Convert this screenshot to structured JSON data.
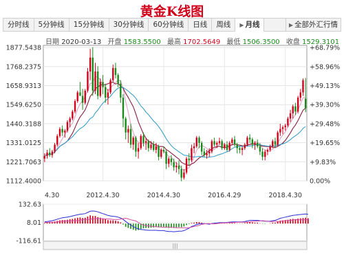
{
  "title": "黄金K线图",
  "tabs": [
    {
      "label": "分时线",
      "active": false
    },
    {
      "label": "5分钟线",
      "active": false
    },
    {
      "label": "15分钟线",
      "active": false
    },
    {
      "label": "30分钟线",
      "active": false
    },
    {
      "label": "60分钟线",
      "active": false
    },
    {
      "label": "日线",
      "active": false
    },
    {
      "label": "周线",
      "active": false
    },
    {
      "label": "月线",
      "active": true
    }
  ],
  "all_markets_label": "全部外汇行情",
  "info": {
    "date_label": "日期",
    "date_value": "2020-03-13",
    "open_label": "开盘",
    "open_value": "1583.5500",
    "high_label": "最高",
    "high_value": "1702.5649",
    "low_label": "最低",
    "low_value": "1506.3500",
    "close_label": "收盘",
    "close_value": "1529.3101"
  },
  "colors": {
    "up": "#d0021b",
    "down": "#1a8a1a",
    "ma_short": "#e0a3c8",
    "ma_mid": "#8b1c3d",
    "ma_long": "#3aa0c9",
    "title": "#d0021b"
  },
  "chart_data": [
    {
      "type": "candlestick",
      "period": "monthly",
      "y_tick_labels": [
        "1877.5438",
        "1768.2375",
        "1658.9313",
        "1549.6250",
        "1440.3188",
        "1331.0125",
        "1221.7063",
        "1112.4000"
      ],
      "y_tick_values": [
        1877.5438,
        1768.2375,
        1658.9313,
        1549.625,
        1440.3188,
        1331.0125,
        1221.7063,
        1112.4
      ],
      "right_tick_labels": [
        "+68.79%",
        "+58.96%",
        "+49.13%",
        "+39.30%",
        "+29.48%",
        "+19.65%",
        "+9.83%",
        "0.00%"
      ],
      "x_tick_labels": [
        "4.30",
        "2012.4.30",
        "2014.4.30",
        "2016.4.29",
        "2018.4.30"
      ],
      "x_tick_index": [
        0,
        23,
        47,
        71,
        95
      ],
      "ylim": [
        1112.4,
        1890
      ],
      "ohlc": [
        [
          1240,
          1270,
          1220,
          1255
        ],
        [
          1255,
          1290,
          1240,
          1275
        ],
        [
          1275,
          1300,
          1250,
          1260
        ],
        [
          1260,
          1290,
          1245,
          1280
        ],
        [
          1280,
          1330,
          1270,
          1320
        ],
        [
          1320,
          1380,
          1310,
          1370
        ],
        [
          1370,
          1420,
          1360,
          1410
        ],
        [
          1410,
          1430,
          1370,
          1390
        ],
        [
          1390,
          1410,
          1360,
          1400
        ],
        [
          1400,
          1460,
          1390,
          1450
        ],
        [
          1450,
          1480,
          1420,
          1470
        ],
        [
          1470,
          1520,
          1460,
          1510
        ],
        [
          1510,
          1580,
          1500,
          1570
        ],
        [
          1570,
          1630,
          1560,
          1620
        ],
        [
          1620,
          1680,
          1610,
          1600
        ],
        [
          1600,
          1640,
          1520,
          1560
        ],
        [
          1560,
          1640,
          1550,
          1630
        ],
        [
          1630,
          1760,
          1620,
          1740
        ],
        [
          1740,
          1870,
          1690,
          1820
        ],
        [
          1820,
          1880,
          1600,
          1630
        ],
        [
          1630,
          1790,
          1610,
          1740
        ],
        [
          1740,
          1770,
          1580,
          1600
        ],
        [
          1600,
          1700,
          1590,
          1680
        ],
        [
          1680,
          1720,
          1610,
          1650
        ],
        [
          1650,
          1670,
          1560,
          1590
        ],
        [
          1590,
          1640,
          1550,
          1620
        ],
        [
          1620,
          1700,
          1610,
          1690
        ],
        [
          1690,
          1780,
          1680,
          1760
        ],
        [
          1760,
          1790,
          1700,
          1720
        ],
        [
          1720,
          1730,
          1650,
          1670
        ],
        [
          1670,
          1690,
          1560,
          1590
        ],
        [
          1590,
          1610,
          1420,
          1470
        ],
        [
          1470,
          1480,
          1350,
          1390
        ],
        [
          1390,
          1430,
          1330,
          1410
        ],
        [
          1410,
          1440,
          1300,
          1320
        ],
        [
          1320,
          1370,
          1290,
          1360
        ],
        [
          1360,
          1370,
          1250,
          1280
        ],
        [
          1280,
          1330,
          1240,
          1300
        ],
        [
          1300,
          1380,
          1290,
          1370
        ],
        [
          1370,
          1390,
          1310,
          1330
        ],
        [
          1330,
          1360,
          1290,
          1340
        ],
        [
          1340,
          1350,
          1280,
          1300
        ],
        [
          1300,
          1340,
          1290,
          1320
        ],
        [
          1320,
          1340,
          1280,
          1290
        ],
        [
          1290,
          1330,
          1270,
          1310
        ],
        [
          1310,
          1320,
          1230,
          1250
        ],
        [
          1250,
          1300,
          1240,
          1290
        ],
        [
          1290,
          1310,
          1270,
          1280
        ],
        [
          1280,
          1290,
          1180,
          1210
        ],
        [
          1210,
          1250,
          1190,
          1240
        ],
        [
          1240,
          1260,
          1200,
          1220
        ],
        [
          1220,
          1240,
          1170,
          1190
        ],
        [
          1190,
          1220,
          1160,
          1200
        ],
        [
          1200,
          1230,
          1150,
          1180
        ],
        [
          1180,
          1200,
          1110,
          1130
        ],
        [
          1130,
          1180,
          1120,
          1160
        ],
        [
          1160,
          1250,
          1150,
          1240
        ],
        [
          1240,
          1270,
          1200,
          1230
        ],
        [
          1230,
          1320,
          1220,
          1300
        ],
        [
          1300,
          1330,
          1270,
          1310
        ],
        [
          1310,
          1370,
          1300,
          1360
        ],
        [
          1360,
          1370,
          1300,
          1330
        ],
        [
          1330,
          1340,
          1260,
          1280
        ],
        [
          1280,
          1300,
          1250,
          1260
        ],
        [
          1260,
          1290,
          1240,
          1270
        ],
        [
          1270,
          1300,
          1250,
          1280
        ],
        [
          1280,
          1350,
          1270,
          1340
        ],
        [
          1340,
          1360,
          1310,
          1320
        ],
        [
          1320,
          1340,
          1300,
          1330
        ],
        [
          1330,
          1360,
          1320,
          1340
        ],
        [
          1340,
          1350,
          1290,
          1300
        ],
        [
          1300,
          1330,
          1290,
          1320
        ],
        [
          1320,
          1340,
          1280,
          1290
        ],
        [
          1290,
          1340,
          1280,
          1330
        ],
        [
          1330,
          1360,
          1320,
          1350
        ],
        [
          1350,
          1370,
          1310,
          1320
        ],
        [
          1320,
          1330,
          1270,
          1300
        ],
        [
          1300,
          1310,
          1270,
          1290
        ],
        [
          1290,
          1310,
          1260,
          1300
        ],
        [
          1300,
          1330,
          1290,
          1320
        ],
        [
          1320,
          1370,
          1310,
          1360
        ],
        [
          1360,
          1380,
          1330,
          1350
        ],
        [
          1350,
          1360,
          1300,
          1320
        ],
        [
          1320,
          1340,
          1290,
          1330
        ],
        [
          1330,
          1350,
          1300,
          1310
        ],
        [
          1310,
          1330,
          1260,
          1280
        ],
        [
          1280,
          1300,
          1230,
          1250
        ],
        [
          1250,
          1290,
          1230,
          1280
        ],
        [
          1280,
          1300,
          1260,
          1290
        ],
        [
          1290,
          1320,
          1280,
          1310
        ],
        [
          1310,
          1350,
          1300,
          1340
        ],
        [
          1340,
          1360,
          1300,
          1320
        ],
        [
          1320,
          1400,
          1310,
          1390
        ],
        [
          1390,
          1440,
          1370,
          1410
        ],
        [
          1410,
          1430,
          1380,
          1420
        ],
        [
          1420,
          1440,
          1400,
          1430
        ],
        [
          1430,
          1480,
          1420,
          1470
        ],
        [
          1470,
          1520,
          1450,
          1500
        ],
        [
          1500,
          1550,
          1470,
          1540
        ],
        [
          1540,
          1560,
          1490,
          1510
        ],
        [
          1510,
          1600,
          1500,
          1590
        ],
        [
          1590,
          1640,
          1570,
          1620
        ],
        [
          1620,
          1700,
          1600,
          1690
        ],
        [
          1583.55,
          1702.5649,
          1506.35,
          1529.3101
        ]
      ]
    },
    {
      "type": "macd-histogram",
      "y_tick_labels": [
        "132.63",
        "8.01",
        "-116.61"
      ],
      "y_tick_values": [
        132.63,
        8.01,
        -116.61
      ],
      "ylim": [
        -116.61,
        132.63
      ],
      "histogram": [
        4,
        6,
        8,
        10,
        14,
        18,
        22,
        24,
        24,
        26,
        30,
        32,
        36,
        40,
        42,
        38,
        40,
        48,
        56,
        52,
        52,
        44,
        40,
        36,
        30,
        24,
        22,
        22,
        20,
        16,
        8,
        -6,
        -22,
        -30,
        -36,
        -42,
        -48,
        -44,
        -36,
        -32,
        -30,
        -30,
        -28,
        -26,
        -24,
        -26,
        -24,
        -22,
        -28,
        -30,
        -28,
        -30,
        -26,
        -24,
        -24,
        -20,
        -10,
        -4,
        4,
        6,
        10,
        10,
        6,
        2,
        -2,
        -4,
        2,
        4,
        4,
        4,
        2,
        2,
        2,
        4,
        6,
        4,
        2,
        2,
        2,
        4,
        8,
        10,
        8,
        6,
        6,
        2,
        -2,
        -2,
        0,
        2,
        6,
        6,
        14,
        20,
        22,
        24,
        26,
        30,
        32,
        30,
        34,
        36,
        38,
        40,
        36
      ],
      "dif": [
        12,
        14,
        17,
        20,
        24,
        30,
        35,
        40,
        42,
        44,
        48,
        52,
        56,
        60,
        64,
        66,
        68,
        76,
        84,
        86,
        84,
        80,
        74,
        68,
        62,
        56,
        52,
        50,
        48,
        44,
        38,
        28,
        14,
        2,
        -10,
        -20,
        -30,
        -36,
        -40,
        -42,
        -44,
        -46,
        -46,
        -46,
        -46,
        -48,
        -48,
        -48,
        -52,
        -54,
        -54,
        -56,
        -54,
        -52,
        -52,
        -48,
        -40,
        -32,
        -20,
        -14,
        -6,
        -2,
        0,
        0,
        -2,
        -4,
        0,
        2,
        4,
        6,
        6,
        6,
        8,
        10,
        12,
        12,
        12,
        12,
        12,
        14,
        18,
        22,
        22,
        22,
        22,
        20,
        18,
        16,
        16,
        16,
        20,
        22,
        28,
        36,
        40,
        44,
        48,
        52,
        56,
        58,
        60,
        62,
        64,
        66,
        64
      ],
      "dea": [
        8,
        8,
        9,
        10,
        10,
        12,
        13,
        16,
        18,
        18,
        18,
        20,
        20,
        20,
        22,
        28,
        28,
        28,
        28,
        34,
        32,
        36,
        34,
        32,
        32,
        32,
        30,
        28,
        28,
        28,
        30,
        34,
        36,
        32,
        26,
        22,
        18,
        8,
        -4,
        -10,
        -14,
        -16,
        -18,
        -20,
        -22,
        -22,
        -24,
        -26,
        -24,
        -24,
        -26,
        -26,
        -28,
        -28,
        -28,
        -28,
        -30,
        -28,
        -24,
        -20,
        -16,
        -12,
        -6,
        -2,
        0,
        0,
        -2,
        -2,
        0,
        2,
        4,
        4,
        6,
        6,
        6,
        8,
        10,
        10,
        10,
        10,
        10,
        12,
        14,
        16,
        16,
        18,
        20,
        18,
        16,
        14,
        14,
        16,
        14,
        16,
        18,
        20,
        22,
        22,
        24,
        28,
        26,
        26,
        26,
        26,
        28
      ]
    }
  ]
}
